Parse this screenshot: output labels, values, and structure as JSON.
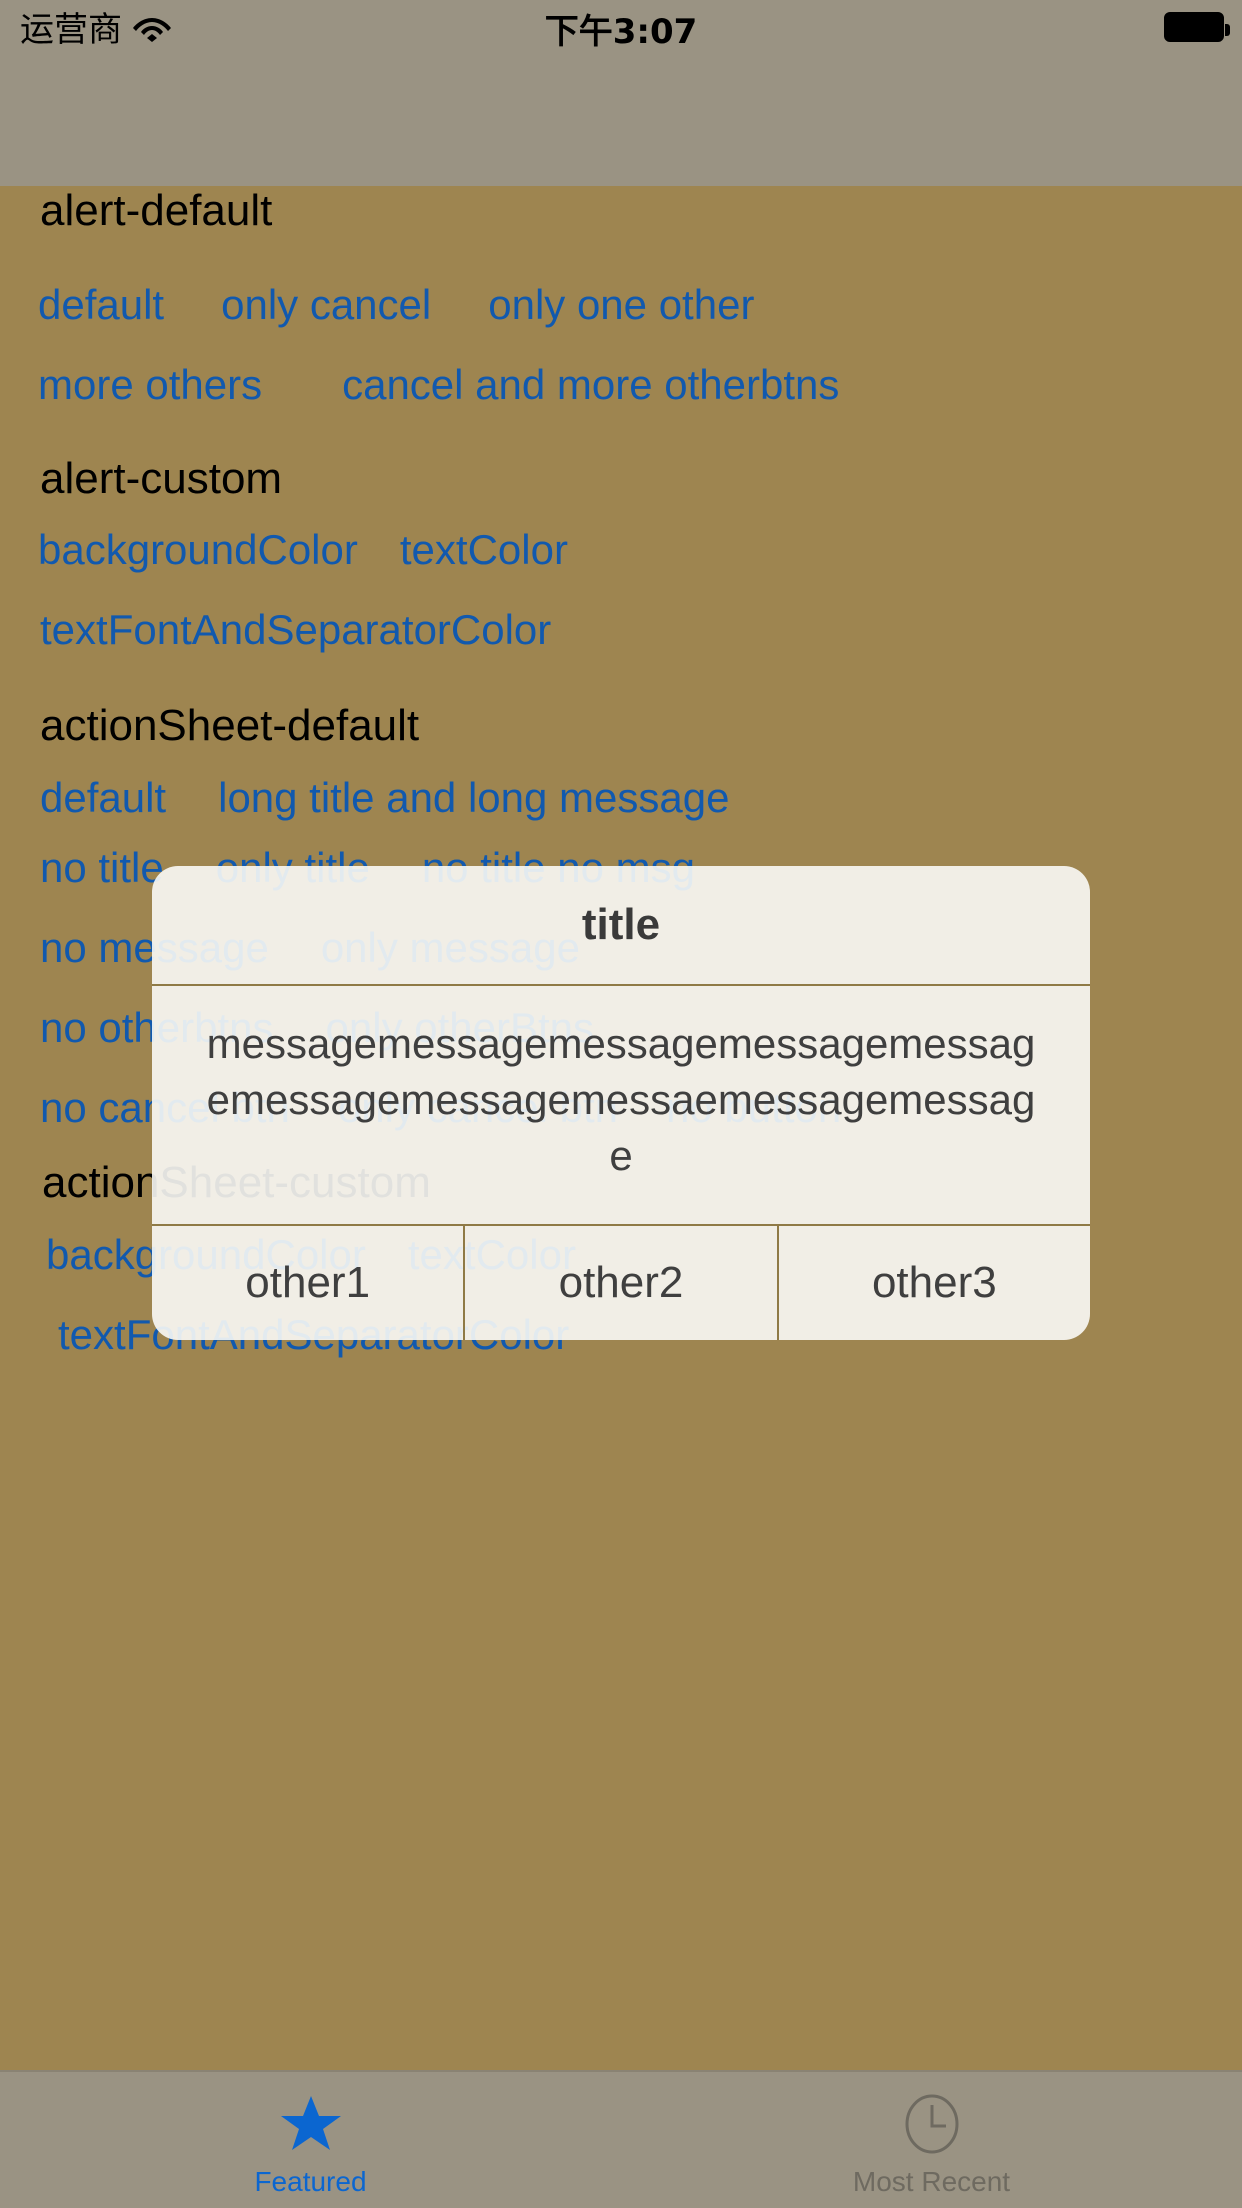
{
  "status_bar": {
    "carrier": "运营商",
    "wifi_icon": "wifi-icon",
    "time": "下午3:07",
    "battery_icon": "battery-full-icon"
  },
  "content": {
    "sections": [
      {
        "title": "alert-default",
        "rows": [
          [
            "default",
            "only cancel",
            "only one other"
          ],
          [
            "more others",
            "cancel and more otherbtns"
          ]
        ]
      },
      {
        "title": "alert-custom",
        "rows": [
          [
            "backgroundColor",
            "textColor"
          ],
          [
            "textFontAndSeparatorColor"
          ]
        ]
      },
      {
        "title": "actionSheet-default",
        "rows": [
          [
            "default",
            "long title and long message"
          ],
          [
            "no title",
            "only title",
            "no title no msg"
          ],
          [
            "no message",
            "only message"
          ],
          [
            "no otherbtns",
            "only otherBtns"
          ],
          [
            "no cancel btn",
            "only cancel btn",
            "no button"
          ]
        ]
      },
      {
        "title": "actionSheet-custom",
        "rows": [
          [
            "backgroundColor",
            "textColor"
          ],
          [
            "textFontAndSeparatorColor"
          ]
        ]
      }
    ]
  },
  "alert": {
    "title": "title",
    "message": "messagemessagemessagemessagemessagemessagemessagemessaemessagemessage",
    "buttons": [
      "other1",
      "other2",
      "other3"
    ]
  },
  "tab_bar": {
    "items": [
      {
        "label": "Featured",
        "icon": "star-icon",
        "selected": true
      },
      {
        "label": "Most Recent",
        "icon": "clock-icon",
        "selected": false
      }
    ]
  },
  "colors": {
    "page_background": "#9e8550",
    "chrome_background": "#9a9383",
    "link_blue": "#1159ae",
    "alert_background": "#faf9f6",
    "separator": "#8f7a46",
    "tab_selected": "#0b66d0",
    "tab_unselected": "#6e6a60"
  }
}
